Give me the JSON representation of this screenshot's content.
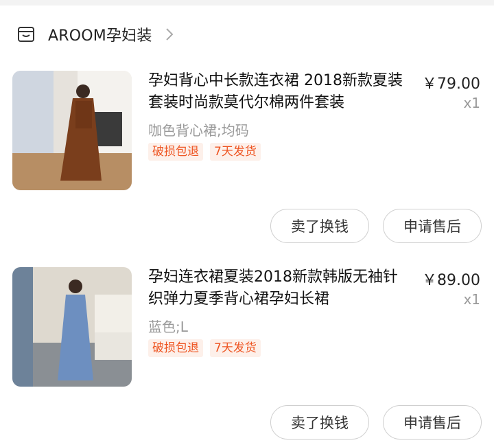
{
  "store": {
    "name": "AROOM孕妇装",
    "icon": "store-icon"
  },
  "items": [
    {
      "title": "孕妇背心中长款连衣裙 2018新款夏装套装时尚款莫代尔棉两件套装",
      "price": "￥79.00",
      "qty": "x1",
      "spec": "咖色背心裙;均码",
      "tags": [
        "破损包退",
        "7天发货"
      ],
      "actions": [
        "卖了换钱",
        "申请售后"
      ]
    },
    {
      "title": "孕妇连衣裙夏装2018新款韩版无袖针织弹力夏季背心裙孕妇长裙",
      "price": "￥89.00",
      "qty": "x1",
      "spec": "蓝色;L",
      "tags": [
        "破损包退",
        "7天发货"
      ],
      "actions": [
        "卖了换钱",
        "申请售后"
      ]
    }
  ],
  "colors": {
    "tag_text": "#ee5522",
    "tag_bg": "#fdf0ea"
  }
}
